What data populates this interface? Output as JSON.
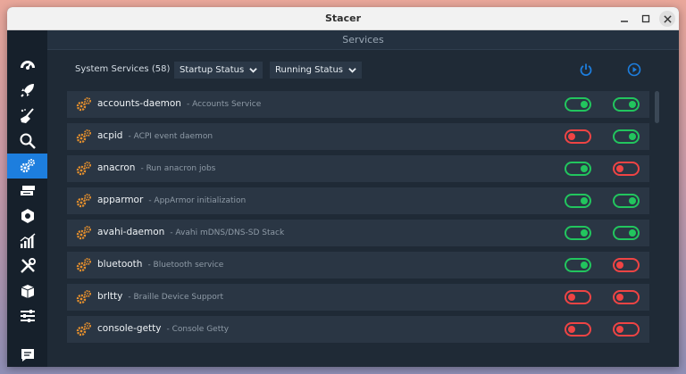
{
  "window": {
    "title": "Stacer"
  },
  "page": {
    "title": "Services"
  },
  "sidebar": {
    "items": [
      {
        "icon": "dashboard-icon"
      },
      {
        "icon": "rocket-icon"
      },
      {
        "icon": "broom-icon"
      },
      {
        "icon": "search-icon"
      },
      {
        "icon": "services-icon",
        "active": true
      },
      {
        "icon": "uninstaller-icon"
      },
      {
        "icon": "resources-icon"
      },
      {
        "icon": "chart-icon"
      },
      {
        "icon": "tools-icon"
      },
      {
        "icon": "package-icon"
      },
      {
        "icon": "settings-sliders-icon"
      },
      {
        "icon": "feedback-icon"
      }
    ]
  },
  "toolbar": {
    "count_label": "System Services (58)",
    "startup_dropdown": "Startup Status",
    "running_dropdown": "Running Status",
    "startup_col_icon": "power-icon",
    "running_col_icon": "play-icon"
  },
  "services": [
    {
      "name": "accounts-daemon",
      "desc": "- Accounts Service",
      "startup": true,
      "running": true
    },
    {
      "name": "acpid",
      "desc": "- ACPI event daemon",
      "startup": false,
      "running": true
    },
    {
      "name": "anacron",
      "desc": "- Run anacron jobs",
      "startup": true,
      "running": false
    },
    {
      "name": "apparmor",
      "desc": "- AppArmor initialization",
      "startup": true,
      "running": true
    },
    {
      "name": "avahi-daemon",
      "desc": "- Avahi mDNS/DNS-SD Stack",
      "startup": true,
      "running": true
    },
    {
      "name": "bluetooth",
      "desc": "- Bluetooth service",
      "startup": true,
      "running": false
    },
    {
      "name": "brltty",
      "desc": "- Braille Device Support",
      "startup": false,
      "running": false
    },
    {
      "name": "console-getty",
      "desc": "- Console Getty",
      "startup": false,
      "running": false
    }
  ],
  "colors": {
    "accent": "#1d7ede",
    "on": "#22c55e",
    "off": "#ef4444",
    "gear": "#e8912d"
  }
}
